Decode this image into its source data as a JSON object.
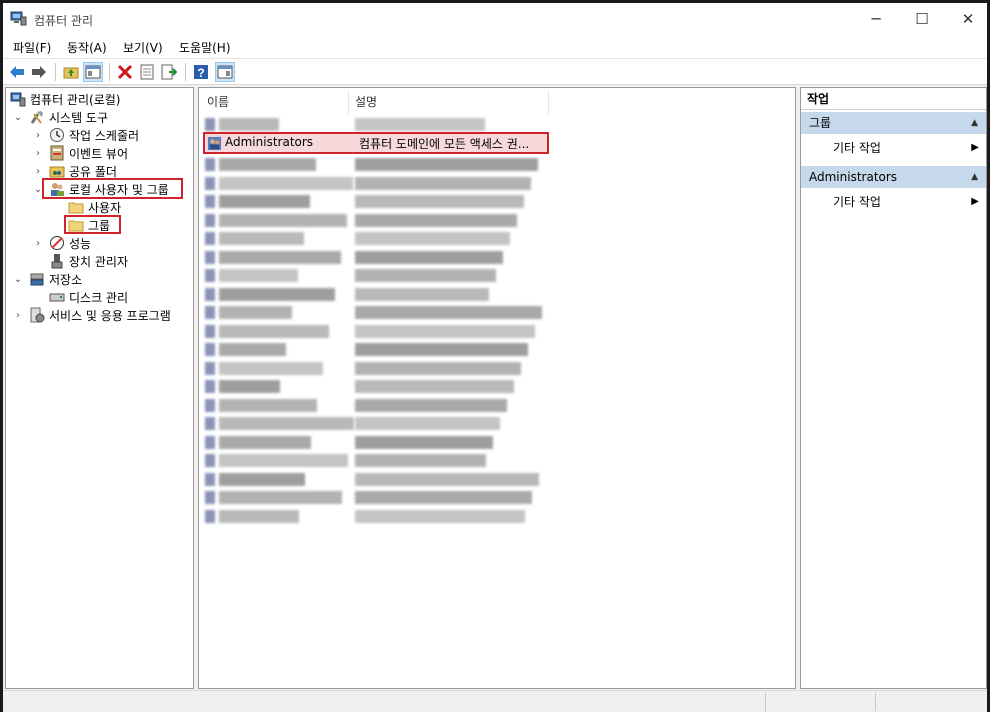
{
  "window": {
    "title": "컴퓨터 관리"
  },
  "menu": [
    "파일(F)",
    "동작(A)",
    "보기(V)",
    "도움말(H)"
  ],
  "toolbar_icons": [
    "back-icon",
    "forward-icon",
    "up-folder-icon",
    "show-hide-tree-icon",
    "delete-icon",
    "properties-icon",
    "export-list-icon",
    "help-icon",
    "show-hide-action-pane-icon"
  ],
  "tree": {
    "root": "컴퓨터 관리(로컬)",
    "system_tools": "시스템 도구",
    "task_scheduler": "작업 스케줄러",
    "event_viewer": "이벤트 뷰어",
    "shared_folders": "공유 폴더",
    "local_users_groups": "로컬 사용자 및 그룹",
    "users": "사용자",
    "groups": "그룹",
    "performance": "성능",
    "device_manager": "장치 관리자",
    "storage": "저장소",
    "disk_management": "디스크 관리",
    "services_apps": "서비스 및 응용 프로그램"
  },
  "list": {
    "columns": {
      "name": "이름",
      "description": "설명"
    },
    "selected_row": {
      "name": "Administrators",
      "description": "컴퓨터 도메인에 모든 액세스 권..."
    },
    "blurred_rows": 20
  },
  "actions": {
    "header": "작업",
    "group1": "그룹",
    "group1_item": "기타 작업",
    "group2": "Administrators",
    "group2_item": "기타 작업"
  },
  "colors": {
    "highlight_red": "#d0232a",
    "action_group_bg": "#c5d8ec"
  }
}
